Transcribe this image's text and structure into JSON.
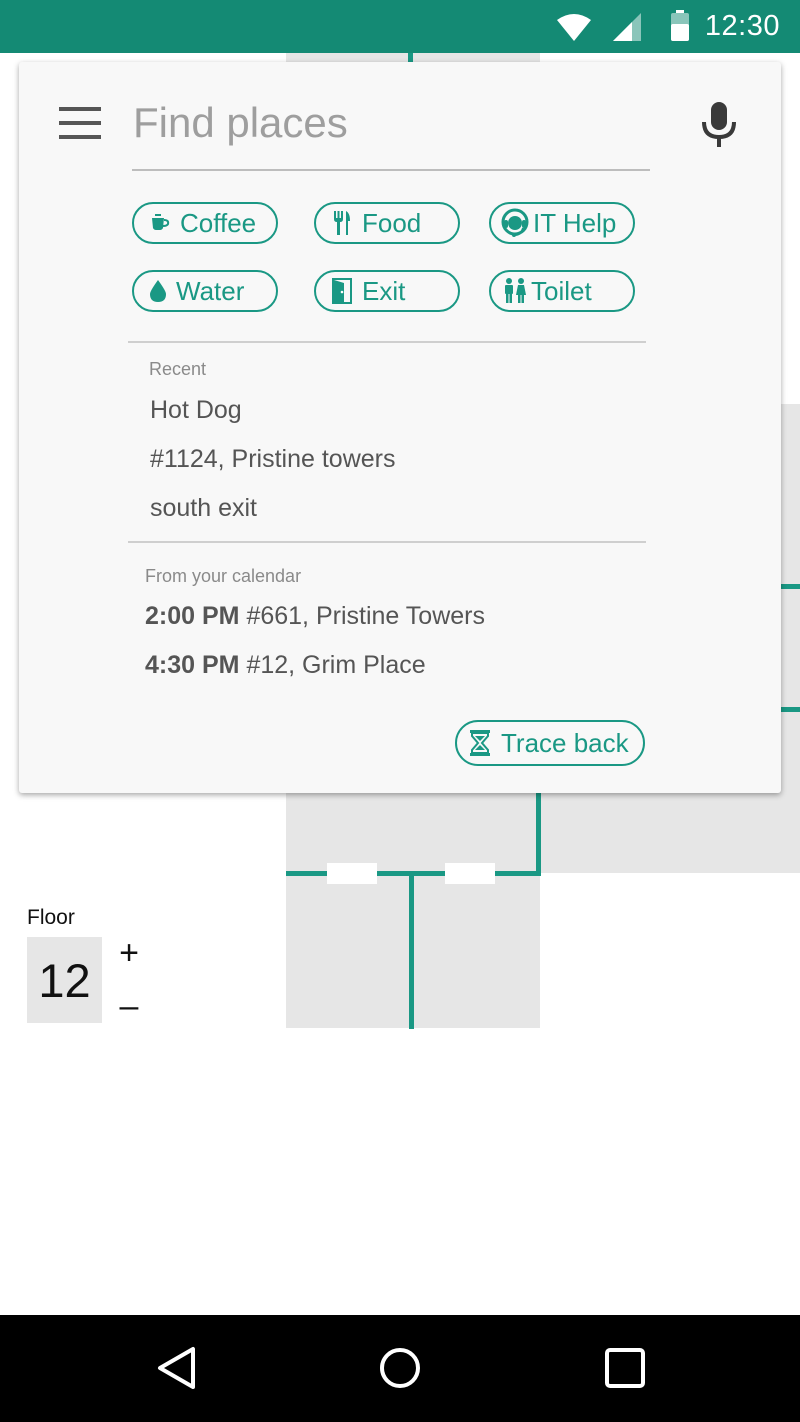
{
  "status_bar": {
    "time": "12:30",
    "icons": [
      "wifi-icon",
      "signal-icon",
      "battery-icon"
    ]
  },
  "search": {
    "placeholder": "Find places",
    "value": ""
  },
  "chips": [
    {
      "label": "Coffee",
      "icon": "coffee-icon"
    },
    {
      "label": "Food",
      "icon": "food-icon"
    },
    {
      "label": "IT Help",
      "icon": "it-help-icon"
    },
    {
      "label": "Water",
      "icon": "water-icon"
    },
    {
      "label": "Exit",
      "icon": "exit-icon"
    },
    {
      "label": "Toilet",
      "icon": "toilet-icon"
    }
  ],
  "recent": {
    "label": "Recent",
    "items": [
      "Hot Dog",
      "#1124, Pristine towers",
      "south exit"
    ]
  },
  "calendar": {
    "label": "From your calendar",
    "items": [
      {
        "time": "2:00 PM",
        "place": "#661, Pristine Towers"
      },
      {
        "time": "4:30 PM",
        "place": "#12, Grim Place"
      }
    ]
  },
  "trace_back": {
    "label": "Trace back",
    "icon": "hourglass-icon"
  },
  "floor": {
    "label": "Floor",
    "value": "12",
    "increment": "+",
    "decrement": "–"
  },
  "nav_bar": {
    "icons": [
      "back-icon",
      "home-icon",
      "recents-icon"
    ]
  },
  "colors": {
    "accent": "#1a9884",
    "status_bar": "#148a74",
    "room": "#e6e6e6"
  }
}
